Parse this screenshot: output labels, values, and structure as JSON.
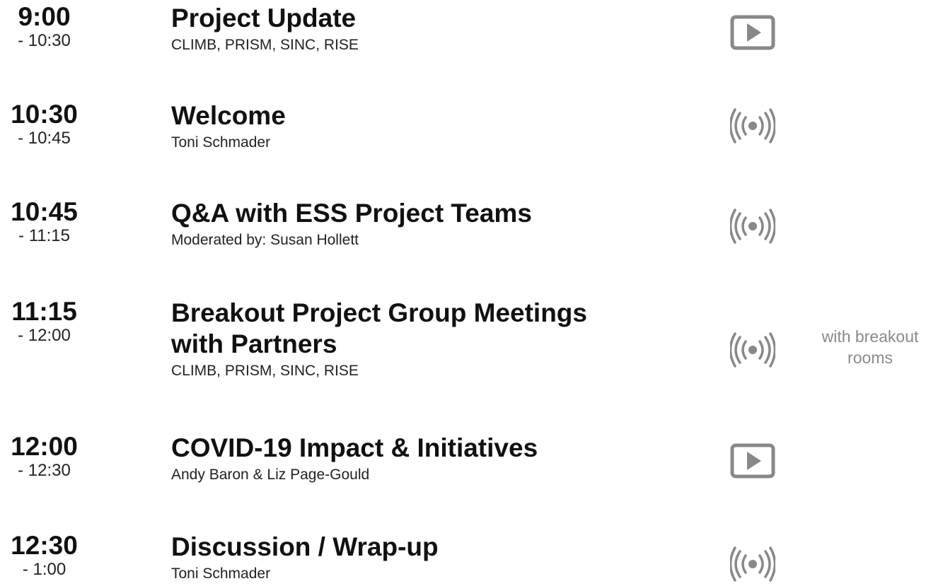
{
  "colors": {
    "text_primary": "#111111",
    "icon_gray": "#888888",
    "note_gray": "#8a8a8a"
  },
  "sessions": [
    {
      "start": "9:00",
      "end": "- 10:30",
      "title": "Project Update",
      "subtitle": "CLIMB, PRISM, SINC, RISE",
      "icon": "play-icon"
    },
    {
      "start": "10:30",
      "end": "- 10:45",
      "title": "Welcome",
      "subtitle": "Toni Schmader",
      "icon": "broadcast-icon"
    },
    {
      "start": "10:45",
      "end": "- 11:15",
      "title": "Q&A with ESS Project Teams",
      "subtitle": "Moderated by: Susan Hollett",
      "icon": "broadcast-icon"
    },
    {
      "start": "11:15",
      "end": "- 12:00",
      "title_line1": "Breakout Project Group Meetings",
      "title_line2": "with Partners",
      "subtitle": "CLIMB, PRISM, SINC, RISE",
      "icon": "broadcast-icon",
      "note_line1": "with breakout",
      "note_line2": "rooms"
    },
    {
      "start": "12:00",
      "end": "- 12:30",
      "title": "COVID-19 Impact & Initiatives",
      "subtitle": "Andy Baron & Liz Page-Gould",
      "icon": "play-icon"
    },
    {
      "start": "12:30",
      "end": "- 1:00",
      "title": "Discussion / Wrap-up",
      "subtitle": "Toni Schmader",
      "icon": "broadcast-icon"
    }
  ]
}
